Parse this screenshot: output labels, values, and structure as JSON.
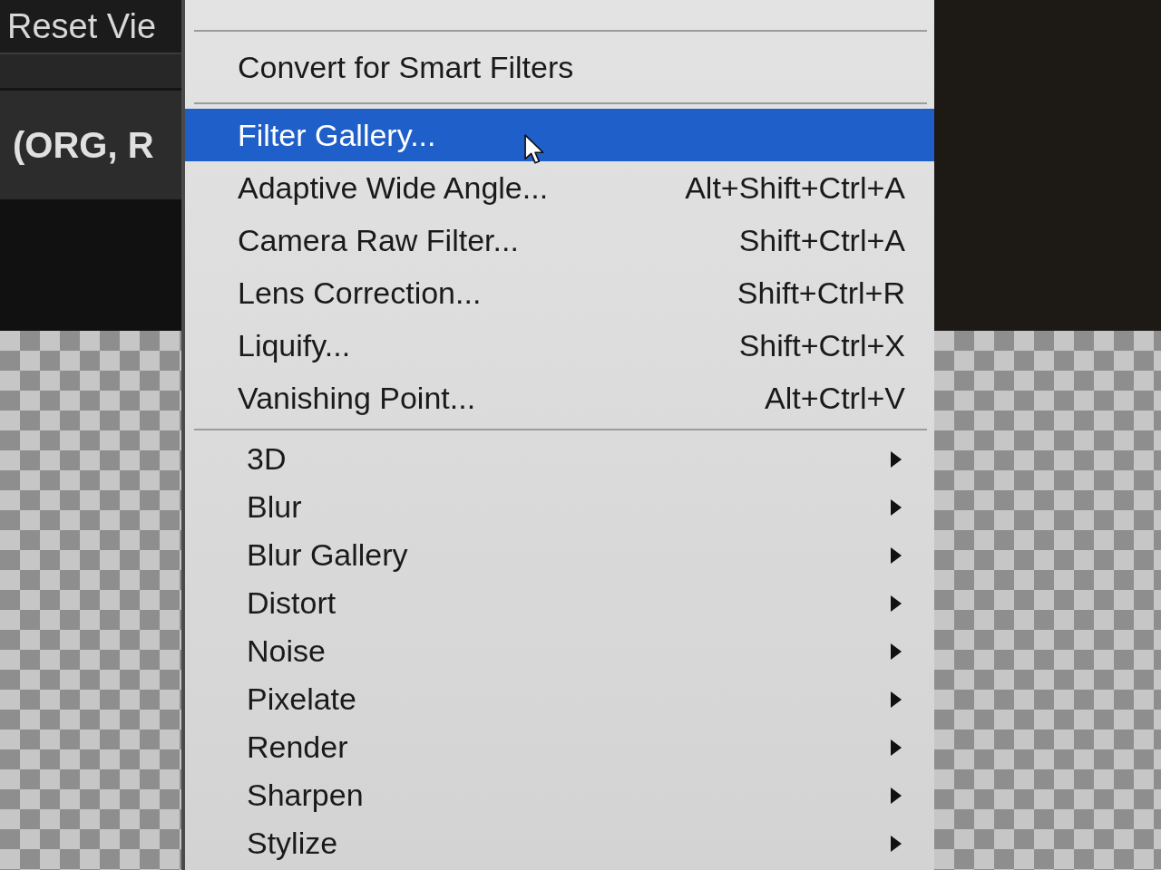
{
  "left_panel": {
    "top_label": "Reset Vie",
    "document_label": "(ORG, R"
  },
  "menu": {
    "sections": [
      {
        "items": [
          {
            "label": "Convert for Smart Filters",
            "has_submenu": false,
            "selected": false
          }
        ]
      },
      {
        "items": [
          {
            "label": "Filter Gallery...",
            "has_submenu": false,
            "selected": true
          },
          {
            "label": "Adaptive Wide Angle...",
            "shortcut": "Alt+Shift+Ctrl+A",
            "has_submenu": false,
            "selected": false
          },
          {
            "label": "Camera Raw Filter...",
            "shortcut": "Shift+Ctrl+A",
            "has_submenu": false,
            "selected": false
          },
          {
            "label": "Lens Correction...",
            "shortcut": "Shift+Ctrl+R",
            "has_submenu": false,
            "selected": false
          },
          {
            "label": "Liquify...",
            "shortcut": "Shift+Ctrl+X",
            "has_submenu": false,
            "selected": false
          },
          {
            "label": "Vanishing Point...",
            "shortcut": "Alt+Ctrl+V",
            "has_submenu": false,
            "selected": false
          }
        ]
      },
      {
        "items": [
          {
            "label": "3D",
            "has_submenu": true,
            "selected": false
          },
          {
            "label": "Blur",
            "has_submenu": true,
            "selected": false
          },
          {
            "label": "Blur Gallery",
            "has_submenu": true,
            "selected": false
          },
          {
            "label": "Distort",
            "has_submenu": true,
            "selected": false
          },
          {
            "label": "Noise",
            "has_submenu": true,
            "selected": false
          },
          {
            "label": "Pixelate",
            "has_submenu": true,
            "selected": false
          },
          {
            "label": "Render",
            "has_submenu": true,
            "selected": false
          },
          {
            "label": "Sharpen",
            "has_submenu": true,
            "selected": false
          },
          {
            "label": "Stylize",
            "has_submenu": true,
            "selected": false
          }
        ]
      }
    ]
  }
}
